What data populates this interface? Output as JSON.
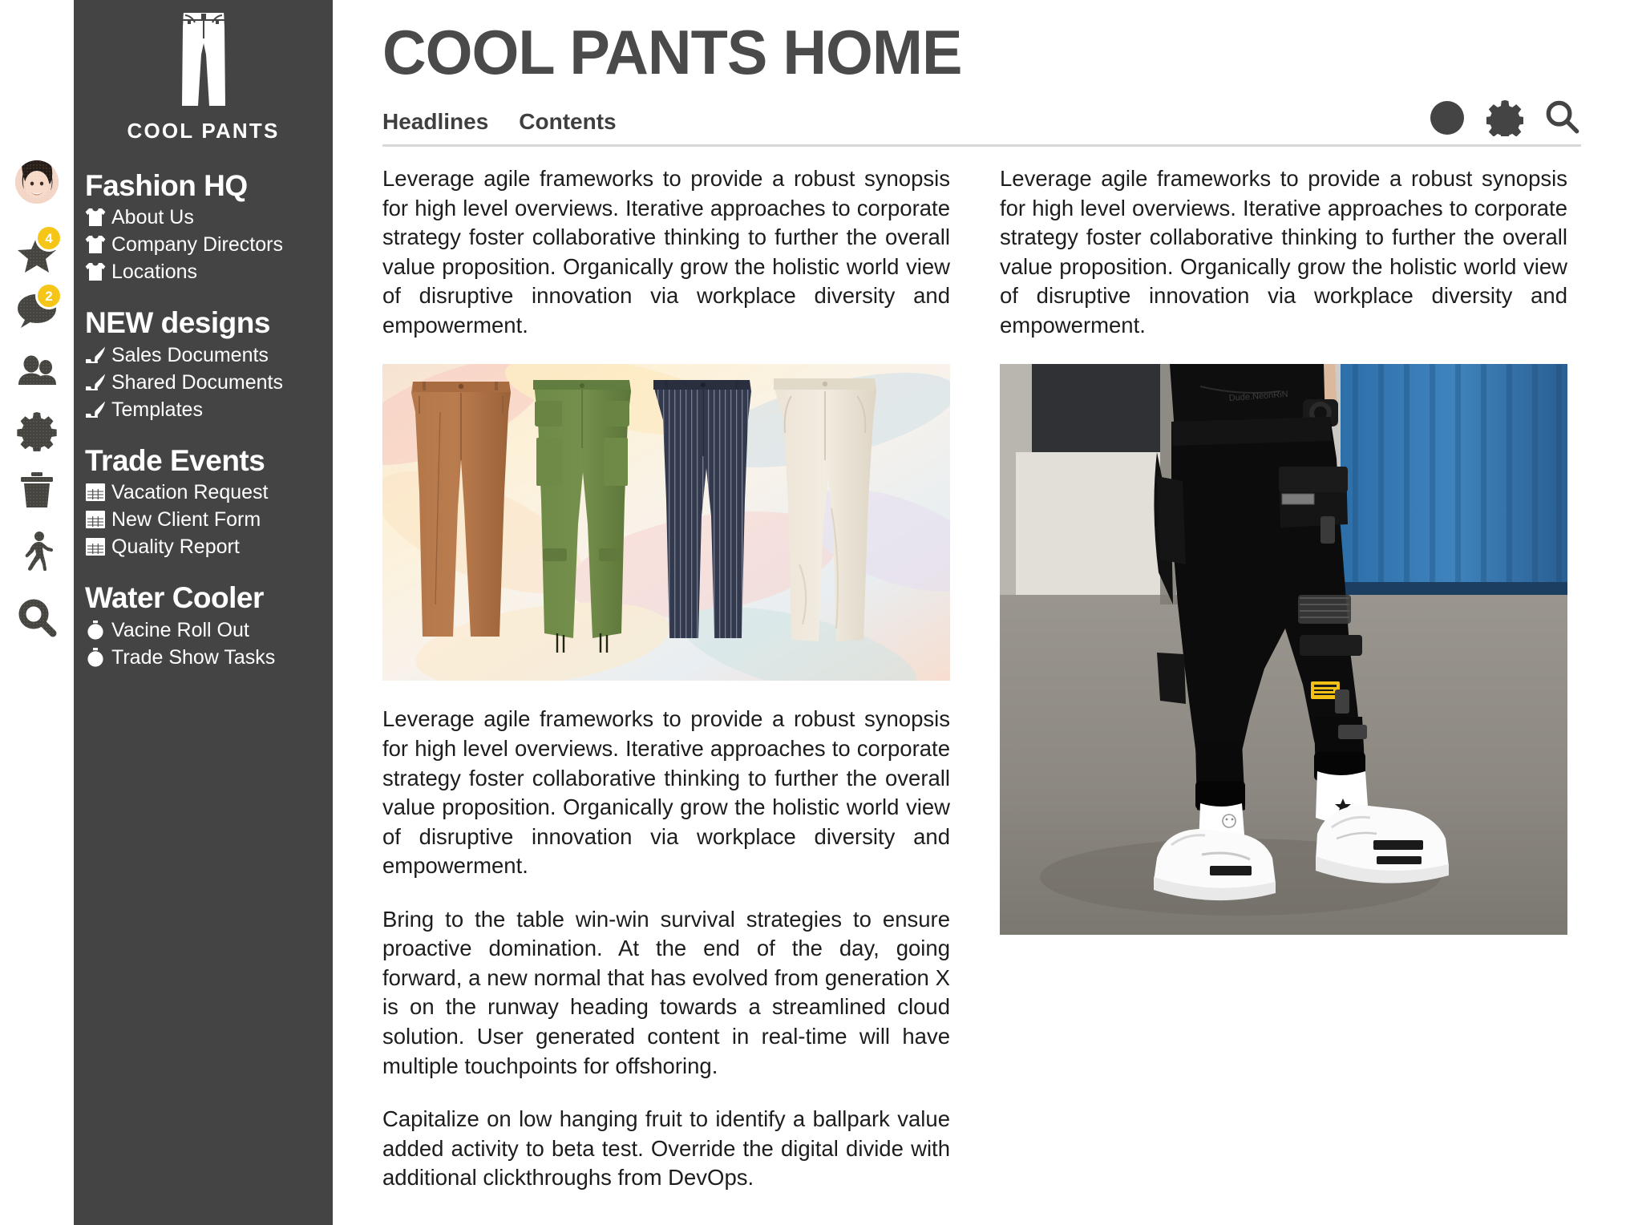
{
  "colors": {
    "sidebar_bg": "#444444",
    "rail_top": "#e09b67",
    "rail_bottom": "#46443f",
    "badge": "#f5c518",
    "title": "#4a4a4a",
    "rule": "#d8d8d8"
  },
  "rail": {
    "items": [
      {
        "name": "avatar",
        "icon": "user-avatar",
        "badge": null
      },
      {
        "name": "favorites",
        "icon": "star-icon",
        "badge": "4"
      },
      {
        "name": "messages",
        "icon": "speech-bubble-icon",
        "badge": "2"
      },
      {
        "name": "contacts",
        "icon": "people-icon",
        "badge": null
      },
      {
        "name": "settings",
        "icon": "gear-icon",
        "badge": null
      },
      {
        "name": "trash",
        "icon": "trash-icon",
        "badge": null
      },
      {
        "name": "activity",
        "icon": "walking-person-icon",
        "badge": null
      },
      {
        "name": "search",
        "icon": "search-icon",
        "badge": null
      }
    ]
  },
  "sidebar": {
    "logo_icon": "pants-icon",
    "brand": "COOL PANTS",
    "sections": [
      {
        "heading": "Fashion HQ",
        "icon": "tshirt-icon",
        "items": [
          "About Us",
          "Company Directors",
          "Locations"
        ]
      },
      {
        "heading": "NEW designs",
        "icon": "high-heel-icon",
        "items": [
          "Sales Documents",
          "Shared Documents",
          "Templates"
        ]
      },
      {
        "heading": "Trade Events",
        "icon": "spreadsheet-icon",
        "items": [
          "Vacation Request",
          "New Client Form",
          "Quality Report"
        ]
      },
      {
        "heading": "Water Cooler",
        "icon": "stopwatch-icon",
        "items": [
          "Vacine Roll Out",
          "Trade Show Tasks"
        ]
      }
    ]
  },
  "header": {
    "title": "COOL PANTS HOME",
    "tabs": [
      {
        "label": "Headlines"
      },
      {
        "label": "Contents"
      }
    ],
    "icons": [
      {
        "name": "add-icon",
        "label": "plus-circle-icon"
      },
      {
        "name": "settings-icon",
        "label": "gear-icon"
      },
      {
        "name": "search-icon",
        "label": "magnifier-icon"
      }
    ]
  },
  "main": {
    "left_column": {
      "paragraph_1": "Leverage agile frameworks to provide a robust synopsis for high level overviews. Iterative approaches to corporate strategy foster collaborative thinking to further the overall value proposition. Organically grow the holistic world view of disruptive innovation via workplace diversity and empowerment.",
      "image_caption": "four-pairs-of-pants-product-shot",
      "paragraph_2": "Leverage agile frameworks to provide a robust synopsis for high level overviews. Iterative approaches to corporate strategy foster collaborative thinking to further the overall value proposition. Organically grow the holistic world view of disruptive innovation via workplace diversity and empowerment.",
      "paragraph_3": "Bring to the table win-win survival strategies to ensure proactive domination. At the end of the day, going forward, a new normal that has evolved from generation X is on the runway heading towards a streamlined cloud solution. User generated content in real-time will have multiple touchpoints for offshoring.",
      "paragraph_4": "Capitalize on low hanging fruit to identify a ballpark value added activity to beta test. Override the digital divide with additional clickthroughs from DevOps."
    },
    "right_column": {
      "paragraph_1": "Leverage agile frameworks to provide a robust synopsis for high level overviews. Iterative approaches to corporate strategy foster collaborative thinking to further the overall value proposition. Organically grow the holistic world view of disruptive innovation via workplace diversity and empowerment.",
      "image_caption": "model-wearing-black-cargo-joggers-street-photo"
    }
  }
}
